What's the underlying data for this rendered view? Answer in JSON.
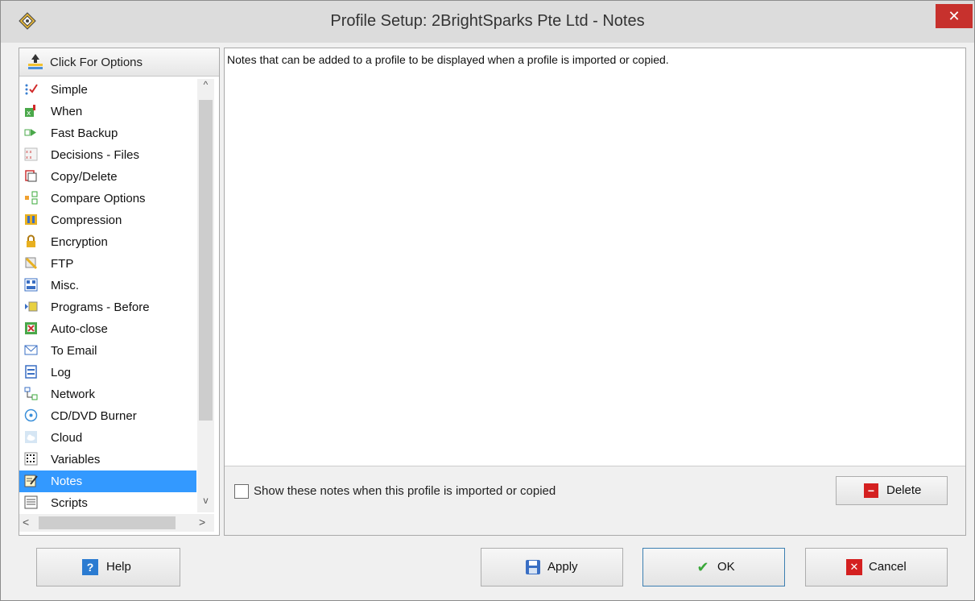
{
  "window": {
    "title": "Profile Setup: 2BrightSparks Pte Ltd - Notes",
    "close_glyph": "✕"
  },
  "options": {
    "header_label": "Click For Options"
  },
  "sidebar": {
    "items": [
      {
        "label": "Simple",
        "icon": "simple-icon"
      },
      {
        "label": "When",
        "icon": "when-icon"
      },
      {
        "label": "Fast Backup",
        "icon": "fast-backup-icon"
      },
      {
        "label": "Decisions - Files",
        "icon": "decisions-icon"
      },
      {
        "label": "Copy/Delete",
        "icon": "copy-delete-icon"
      },
      {
        "label": "Compare Options",
        "icon": "compare-icon"
      },
      {
        "label": "Compression",
        "icon": "compression-icon"
      },
      {
        "label": "Encryption",
        "icon": "lock-icon"
      },
      {
        "label": "FTP",
        "icon": "ftp-icon"
      },
      {
        "label": "Misc.",
        "icon": "misc-icon"
      },
      {
        "label": "Programs - Before",
        "icon": "programs-icon"
      },
      {
        "label": "Auto-close",
        "icon": "auto-close-icon"
      },
      {
        "label": "To Email",
        "icon": "email-icon"
      },
      {
        "label": "Log",
        "icon": "log-icon"
      },
      {
        "label": "Network",
        "icon": "network-icon"
      },
      {
        "label": "CD/DVD Burner",
        "icon": "disc-icon"
      },
      {
        "label": "Cloud",
        "icon": "cloud-icon"
      },
      {
        "label": "Variables",
        "icon": "variables-icon"
      },
      {
        "label": "Notes",
        "icon": "notes-icon",
        "selected": true
      },
      {
        "label": "Scripts",
        "icon": "scripts-icon"
      }
    ],
    "scroll_up": "^",
    "scroll_down": "v",
    "scroll_left": "<",
    "scroll_right": ">"
  },
  "main": {
    "notes_text": "Notes that can be added to a profile to be displayed when a profile is imported or copied.",
    "show_checkbox_label": "Show these notes when this profile is imported or copied",
    "show_checked": false,
    "delete_label": "Delete",
    "delete_glyph": "−"
  },
  "footer": {
    "help_label": "Help",
    "apply_label": "Apply",
    "ok_label": "OK",
    "cancel_label": "Cancel",
    "help_glyph": "?",
    "cancel_glyph": "✕",
    "ok_glyph": "✔"
  },
  "colors": {
    "selection": "#3399ff",
    "close_button": "#c7312d",
    "delete_icon": "#d42020",
    "ok_check": "#3aa83a",
    "help_icon": "#2b7bd1",
    "apply_icon": "#3a6fc4"
  }
}
